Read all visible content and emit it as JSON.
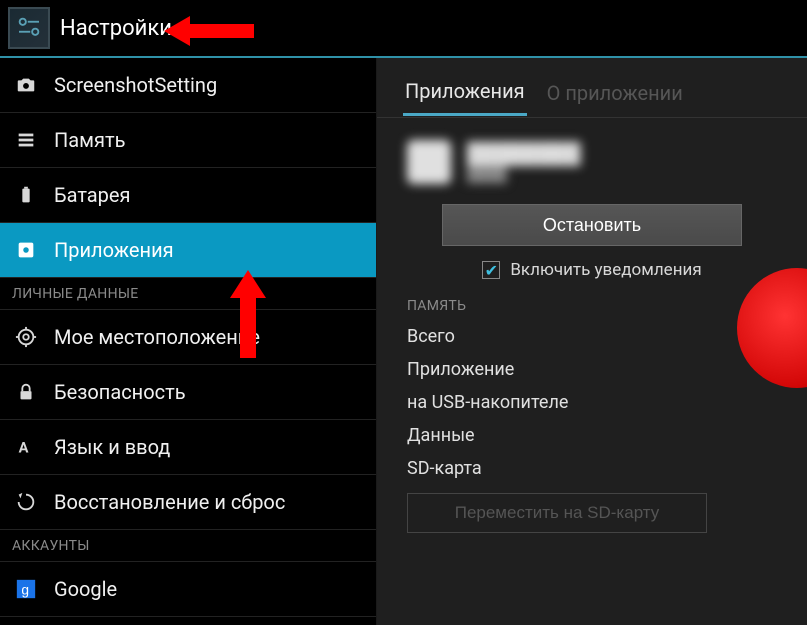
{
  "header": {
    "title": "Настройки"
  },
  "sidebar": {
    "items": [
      {
        "label": "ScreenshotSetting"
      },
      {
        "label": "Память"
      },
      {
        "label": "Батарея"
      },
      {
        "label": "Приложения"
      }
    ],
    "section_personal": "ЛИЧНЫЕ ДАННЫЕ",
    "personal": [
      {
        "label": "Мое местоположение"
      },
      {
        "label": "Безопасность"
      },
      {
        "label": "Язык и ввод"
      },
      {
        "label": "Восстановление и сброс"
      }
    ],
    "section_accounts": "АККАУНТЫ",
    "accounts": [
      {
        "label": "Google"
      }
    ]
  },
  "content": {
    "tabs": {
      "active": "Приложения",
      "inactive": "О приложении"
    },
    "stop_button": "Остановить",
    "notifications_label": "Включить уведомления",
    "memory_header": "ПАМЯТЬ",
    "memory_rows": {
      "total": "Всего",
      "app": "Приложение",
      "usb": "на USB-накопителе",
      "data": "Данные",
      "sd": "SD-карта"
    },
    "move_button": "Переместить на SD-карту"
  }
}
